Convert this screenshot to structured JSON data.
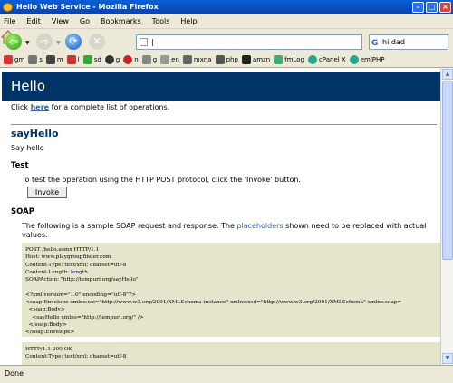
{
  "window": {
    "title": "Hello Web Service - Mozilla Firefox"
  },
  "menu": [
    "File",
    "Edit",
    "View",
    "Go",
    "Bookmarks",
    "Tools",
    "Help"
  ],
  "toolbar": {
    "url_value": "|",
    "search_value": "hi dad"
  },
  "bookmarks": [
    {
      "label": "gm"
    },
    {
      "label": "s"
    },
    {
      "label": "m"
    },
    {
      "label": "l"
    },
    {
      "label": "sd"
    },
    {
      "label": "g"
    },
    {
      "label": "n"
    },
    {
      "label": "g"
    },
    {
      "label": "en"
    },
    {
      "label": "mxna"
    },
    {
      "label": "php"
    },
    {
      "label": "amzn"
    },
    {
      "label": "fmLog"
    },
    {
      "label": "cPanel X"
    },
    {
      "label": "emlPHP"
    }
  ],
  "page": {
    "header": "Hello",
    "intro_before": "Click ",
    "intro_link": "here",
    "intro_after": " for a complete list of operations.",
    "op_title": "sayHello",
    "op_desc": "Say hello",
    "test_heading": "Test",
    "test_text": "To test the operation using the HTTP POST protocol, click the 'Invoke' button.",
    "invoke_label": "Invoke",
    "soap_heading": "SOAP",
    "soap_before": "The following is a sample SOAP request and response. The ",
    "soap_link": "placeholders",
    "soap_after": " shown need to be replaced with actual values.",
    "request_code": [
      "POST /hello.asmx HTTP/1.1",
      "Host: www.playgroupfinder.com",
      "Content-Type: text/xml; charset=utf-8",
      "Content-Length: ",
      "SOAPAction: \"http://tempuri.org/sayHello\"",
      "",
      "<?xml version=\"1.0\" encoding=\"utf-8\"?>",
      "<soap:Envelope xmlns:xsi=\"http://www.w3.org/2001/XMLSchema-instance\" xmlns:xsd=\"http://www.w3.org/2001/XMLSchema\" xmlns:soap=",
      "  <soap:Body>",
      "    <sayHello xmlns=\"http://tempuri.org/\" />",
      "  </soap:Body>",
      "</soap:Envelope>"
    ],
    "length_placeholder": "length",
    "response_code": [
      "HTTP/1.1 200 OK",
      "Content-Type: text/xml; charset=utf-8"
    ]
  },
  "status": "Done"
}
